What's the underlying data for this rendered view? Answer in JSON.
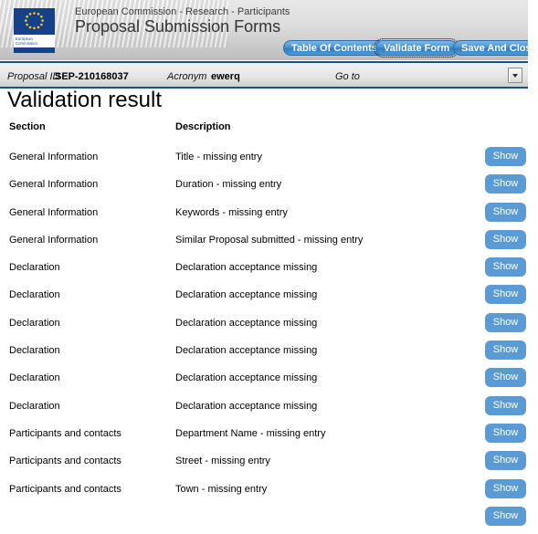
{
  "banner": {
    "supertitle": "European Commission - Research - Participants",
    "title": "Proposal Submission Forms",
    "logo": {
      "caption_line1": "European",
      "caption_line2": "Commission",
      "flag_color": "#17408b",
      "star_color": "#ffcc00"
    },
    "buttons": {
      "table_of_contents": "Table Of Contents",
      "validate_form": "Validate Form",
      "save_and_close": "Save And Close"
    },
    "accent_color": "#4a90d0"
  },
  "proposal_bar": {
    "proposal_id_label": "Proposal ID",
    "proposal_id_value": "SEP-210168037",
    "acronym_label": "Acronym",
    "acronym_value": "ewerq",
    "goto_label": "Go to",
    "dropdown_icon": "chevron-down-icon",
    "border_color": "#1b4f8c"
  },
  "page": {
    "title": "Validation result"
  },
  "table": {
    "columns": [
      "Section",
      "Description"
    ],
    "action_label": "Show",
    "action_color": "#5b9bd5",
    "rows": [
      {
        "section": "General Information",
        "description": "Title - missing entry"
      },
      {
        "section": "General Information",
        "description": "Duration - missing entry"
      },
      {
        "section": "General Information",
        "description": "Keywords - missing entry"
      },
      {
        "section": "General Information",
        "description": "Similar Proposal submitted - missing entry"
      },
      {
        "section": "Declaration",
        "description": "Declaration acceptance missing"
      },
      {
        "section": "Declaration",
        "description": "Declaration acceptance missing"
      },
      {
        "section": "Declaration",
        "description": "Declaration acceptance missing"
      },
      {
        "section": "Declaration",
        "description": "Declaration acceptance missing"
      },
      {
        "section": "Declaration",
        "description": "Declaration acceptance missing"
      },
      {
        "section": "Declaration",
        "description": "Declaration acceptance missing"
      },
      {
        "section": "Participants and contacts",
        "description": "Department Name - missing entry"
      },
      {
        "section": "Participants and contacts",
        "description": "Street - missing entry"
      },
      {
        "section": "Participants and contacts",
        "description": "Town - missing entry"
      },
      {
        "section": "",
        "description": ""
      }
    ]
  }
}
